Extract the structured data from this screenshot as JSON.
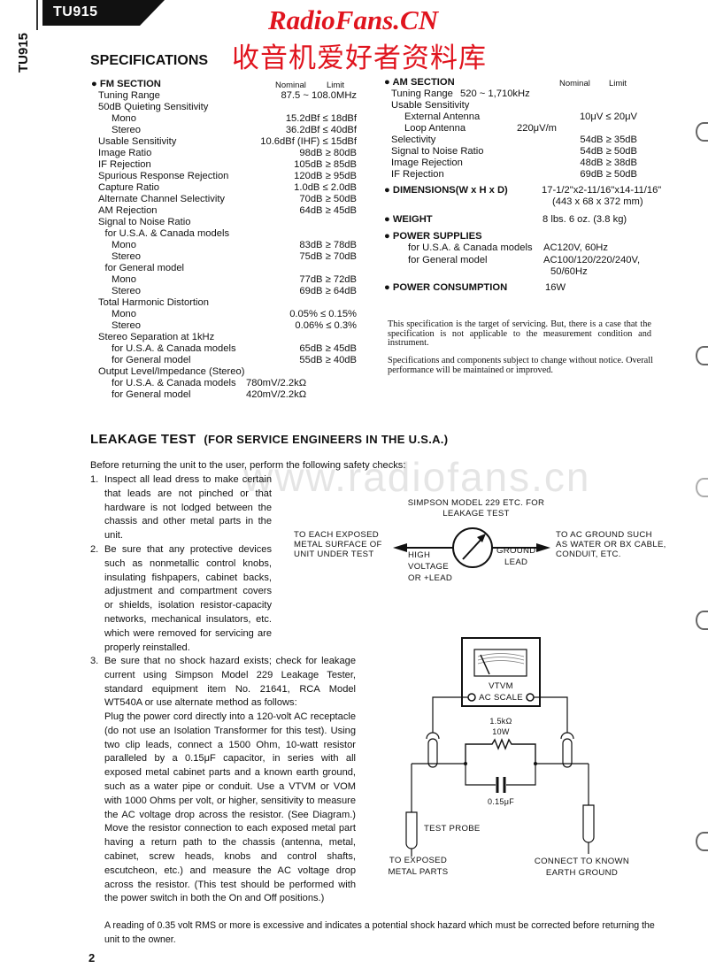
{
  "header": {
    "model_tab": "TU915",
    "side_model": "TU915",
    "watermark_title": "RadioFans.CN",
    "watermark_cn": "收音机爱好者资料库",
    "watermark_url": "www.radiofans.cn",
    "section_title": "SPECIFICATIONS"
  },
  "fm": {
    "heading": "FM SECTION",
    "col_nominal": "Nominal",
    "col_limit": "Limit",
    "rows": [
      {
        "label": "Tuning Range",
        "indent": 1,
        "value": "87.5 ~ 108.0MHz"
      },
      {
        "label": "50dB Quieting Sensitivity",
        "indent": 1,
        "value": ""
      },
      {
        "label": "Mono",
        "indent": 2,
        "value": "15.2dBf ≤ 18dBf"
      },
      {
        "label": "Stereo",
        "indent": 2,
        "value": "36.2dBf ≤ 40dBf"
      },
      {
        "label": "Usable Sensitivity",
        "indent": 1,
        "value": "10.6dBf (IHF) ≤ 15dBf"
      },
      {
        "label": "Image Ratio",
        "indent": 1,
        "value": "98dB ≥ 80dB"
      },
      {
        "label": "IF Rejection",
        "indent": 1,
        "value": "105dB ≥ 85dB"
      },
      {
        "label": "Spurious Response Rejection",
        "indent": 1,
        "value": "120dB ≥ 95dB"
      },
      {
        "label": "Capture Ratio",
        "indent": 1,
        "value": "1.0dB ≤ 2.0dB"
      },
      {
        "label": "Alternate Channel Selectivity",
        "indent": 1,
        "value": "70dB ≥ 50dB"
      },
      {
        "label": "AM Rejection",
        "indent": 1,
        "value": "64dB ≥ 45dB"
      },
      {
        "label": "Signal to Noise Ratio",
        "indent": 1,
        "value": ""
      },
      {
        "label": "for U.S.A. & Canada models",
        "indent": 1.5,
        "value": ""
      },
      {
        "label": "Mono",
        "indent": 2,
        "value": "83dB ≥ 78dB"
      },
      {
        "label": "Stereo",
        "indent": 2,
        "value": "75dB ≥ 70dB"
      },
      {
        "label": "for General model",
        "indent": 1.5,
        "value": ""
      },
      {
        "label": "Mono",
        "indent": 2,
        "value": "77dB ≥ 72dB"
      },
      {
        "label": "Stereo",
        "indent": 2,
        "value": "69dB ≥ 64dB"
      },
      {
        "label": "Total Harmonic Distortion",
        "indent": 1,
        "value": ""
      },
      {
        "label": "Mono",
        "indent": 2,
        "value": "0.05% ≤ 0.15%"
      },
      {
        "label": "Stereo",
        "indent": 2,
        "value": "0.06% ≤ 0.3%"
      },
      {
        "label": "Stereo Separation at 1kHz",
        "indent": 1,
        "value": ""
      },
      {
        "label": "for U.S.A. & Canada models",
        "indent": 2,
        "value": "65dB ≥ 45dB"
      },
      {
        "label": "for General model",
        "indent": 2,
        "value": "55dB ≥ 40dB"
      },
      {
        "label": "Output Level/Impedance (Stereo)",
        "indent": 1,
        "value": ""
      },
      {
        "label": "for U.S.A. & Canada models",
        "indent": 2,
        "value": "780mV/2.2kΩ",
        "left": true
      },
      {
        "label": "for General model",
        "indent": 2,
        "value": "420mV/2.2kΩ",
        "left": true
      }
    ]
  },
  "am": {
    "heading": "AM SECTION",
    "col_nominal": "Nominal",
    "col_limit": "Limit",
    "rows": [
      {
        "label": "Tuning Range",
        "indent": 1,
        "value": "520 ~ 1,710kHz",
        "left": true
      },
      {
        "label": "Usable Sensitivity",
        "indent": 1,
        "value": ""
      },
      {
        "label": "External Antenna",
        "indent": 2,
        "value": "10μV ≤ 20μV"
      },
      {
        "label": "Loop Antenna",
        "indent": 2,
        "value": "220μV/m",
        "mid": true
      },
      {
        "label": "Selectivity",
        "indent": 1,
        "value": "54dB ≥ 35dB"
      },
      {
        "label": "Signal to Noise Ratio",
        "indent": 1,
        "value": "54dB ≥ 50dB"
      },
      {
        "label": "Image Rejection",
        "indent": 1,
        "value": "48dB ≥ 38dB"
      },
      {
        "label": "IF Rejection",
        "indent": 1,
        "value": "69dB ≥ 50dB"
      }
    ]
  },
  "general": {
    "dimensions_label": "DIMENSIONS(W x H x D)",
    "dimensions_in": "17-1/2\"x2-11/16\"x14-11/16\"",
    "dimensions_mm": "(443 x 68 x 372 mm)",
    "weight_label": "WEIGHT",
    "weight_value": "8 lbs. 6 oz. (3.8 kg)",
    "power_label": "POWER SUPPLIES",
    "power_usa_label": "for U.S.A. & Canada models",
    "power_usa_value": "AC120V, 60Hz",
    "power_gen_label": "for General model",
    "power_gen_value1": "AC100/120/220/240V,",
    "power_gen_value2": "50/60Hz",
    "consumption_label": "POWER CONSUMPTION",
    "consumption_value": "16W"
  },
  "notes": {
    "note1": "This specification is the target of servicing. But, there is a case that the specification is not applicable to the measurement condition and instrument.",
    "note2": "Specifications and components subject to change without notice. Overall performance will be maintained or improved."
  },
  "leakage": {
    "title": "LEAKAGE TEST",
    "subtitle": "(FOR SERVICE ENGINEERS IN THE U.S.A.)",
    "intro": "Before returning the unit to the user, perform the following safety checks:",
    "item1_num": "1.",
    "item1": "Inspect all lead dress to make certain that leads are not pinched or that hardware is not lodged between the chassis and other metal parts in the unit.",
    "item2_num": "2.",
    "item2": "Be sure that any protective devices such as nonmetallic control knobs, insulating fishpapers, cabinet backs, adjustment and compartment covers or shields, isolation resistor-capacity networks, mechanical insulators, etc. which were removed for servicing are properly reinstalled.",
    "item3_num": "3.",
    "item3": "Be sure that no shock hazard exists; check for leakage current using Simpson Model 229 Leakage Tester, standard equipment item No. 21641, RCA Model WT540A or use alternate method as follows:",
    "item3b": "Plug the power cord directly into a 120-volt AC receptacle (do not use an Isolation Transformer for this test). Using two clip leads, connect a 1500 Ohm, 10-watt resistor paralleled by a 0.15μF capacitor, in series with all exposed metal cabinet parts and a known earth ground, such as a water pipe or conduit. Use a VTVM or VOM with 1000 Ohms per volt, or higher, sensitivity to measure the AC voltage drop across the resistor. (See Diagram.) Move the resistor connection to each exposed metal part having a return path to the chassis (antenna, metal, cabinet, screw heads, knobs and control shafts, escutcheon, etc.) and measure the AC voltage drop across the resistor. (This test should be performed with the power switch in both the On and Off positions.)",
    "closing": "A reading of 0.35 volt RMS or more is excessive and indicates a potential shock hazard which must be corrected before returning the unit to the owner."
  },
  "diagram1": {
    "title1": "SIMPSON MODEL 229 ETC. FOR",
    "title2": "LEAKAGE TEST",
    "left1": "TO EACH EXPOSED",
    "left2": "METAL SURFACE OF",
    "left3": "UNIT UNDER TEST",
    "hv1": "HIGH",
    "hv2": "VOLTAGE",
    "hv3": "OR +LEAD",
    "gl1": "GROUND",
    "gl2": "LEAD",
    "right1": "TO AC GROUND SUCH",
    "right2": "AS WATER OR BX CABLE,",
    "right3": "CONDUIT, ETC."
  },
  "diagram2": {
    "meter_label": "VTVM",
    "scale_label": "AC SCALE",
    "resistor1": "1.5kΩ",
    "resistor2": "10W",
    "capacitor": "0.15μF",
    "probe": "TEST PROBE",
    "left1": "TO EXPOSED",
    "left2": "METAL PARTS",
    "right1": "CONNECT TO KNOWN",
    "right2": "EARTH GROUND"
  },
  "footer": {
    "page_number": "2"
  }
}
